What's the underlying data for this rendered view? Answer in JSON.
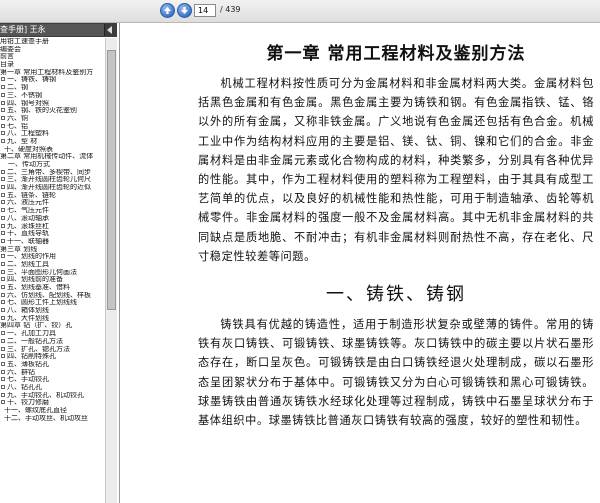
{
  "toolbar": {
    "prev_icon": "arrow-up-icon",
    "next_icon": "arrow-down-icon",
    "current_page": "14",
    "total_pages": "/ 439"
  },
  "panel": {
    "tab_title": "查手册] 王永",
    "items": [
      {
        "label": "用钳工速查手册",
        "box": false,
        "indent": 0
      },
      {
        "label": "编委会",
        "box": false,
        "indent": 0
      },
      {
        "label": "前言",
        "box": false,
        "indent": 0
      },
      {
        "label": "目录",
        "box": false,
        "indent": 0
      },
      {
        "label": "第一章  常用工程材料及鉴别方",
        "box": false,
        "indent": 0
      },
      {
        "label": "一、铸铁、铸钢",
        "box": true,
        "indent": 0
      },
      {
        "label": "二、钢",
        "box": true,
        "indent": 0
      },
      {
        "label": "三、不锈钢",
        "box": true,
        "indent": 0
      },
      {
        "label": "四、钢号对照",
        "box": true,
        "indent": 0
      },
      {
        "label": "五、钢、铁的火花鉴别",
        "box": true,
        "indent": 0
      },
      {
        "label": "六、铜",
        "box": true,
        "indent": 0
      },
      {
        "label": "七、铝",
        "box": true,
        "indent": 0
      },
      {
        "label": "八、工程塑料",
        "box": true,
        "indent": 0
      },
      {
        "label": "九、型  材",
        "box": true,
        "indent": 0
      },
      {
        "label": "十、硬度对照表",
        "box": false,
        "indent": 1
      },
      {
        "label": "第二章  常用机械传动件、流体",
        "box": false,
        "indent": 0
      },
      {
        "label": "一、传动方式",
        "box": false,
        "indent": 2
      },
      {
        "label": "二、三角带、多楔带、同步",
        "box": true,
        "indent": 0
      },
      {
        "label": "三、渐开线圆柱齿轮几何尺",
        "box": true,
        "indent": 0
      },
      {
        "label": "四、渐开线圆柱齿轮的近似",
        "box": true,
        "indent": 0
      },
      {
        "label": "五、链条、链轮",
        "box": true,
        "indent": 0
      },
      {
        "label": "六、液压元件",
        "box": true,
        "indent": 0
      },
      {
        "label": "七、气压元件",
        "box": true,
        "indent": 0
      },
      {
        "label": "八、滚动轴承",
        "box": true,
        "indent": 0
      },
      {
        "label": "九、滚珠丝杠",
        "box": true,
        "indent": 0
      },
      {
        "label": "十、直线导轨",
        "box": true,
        "indent": 0
      },
      {
        "label": "十一、联轴器",
        "box": true,
        "indent": 0
      },
      {
        "label": "第三章  划线",
        "box": false,
        "indent": 0
      },
      {
        "label": "一、划线的作用",
        "box": true,
        "indent": 0
      },
      {
        "label": "二、划线工具",
        "box": true,
        "indent": 0
      },
      {
        "label": "三、平面图形几何画法",
        "box": true,
        "indent": 0
      },
      {
        "label": "四、划线前的准备",
        "box": true,
        "indent": 0
      },
      {
        "label": "五、划线基准、借料",
        "box": true,
        "indent": 0
      },
      {
        "label": "六、仿划线、配划线、样板",
        "box": true,
        "indent": 0
      },
      {
        "label": "七、圆形工件上划线线",
        "box": true,
        "indent": 0
      },
      {
        "label": "八、箱体划线",
        "box": true,
        "indent": 0
      },
      {
        "label": "九、大件划线",
        "box": true,
        "indent": 0
      },
      {
        "label": "第四章  钻（扩、铰）孔",
        "box": false,
        "indent": 0
      },
      {
        "label": "一、孔加工刀具",
        "box": true,
        "indent": 0
      },
      {
        "label": "二、一般钻孔方法",
        "box": true,
        "indent": 0
      },
      {
        "label": "三、扩孔、锪孔方法",
        "box": true,
        "indent": 0
      },
      {
        "label": "四、钻削特殊孔",
        "box": true,
        "indent": 0
      },
      {
        "label": "五、薄板钻孔",
        "box": true,
        "indent": 0
      },
      {
        "label": "六、群钻",
        "box": true,
        "indent": 0
      },
      {
        "label": "七、手动铰孔",
        "box": true,
        "indent": 0
      },
      {
        "label": "八、钻孔孔",
        "box": true,
        "indent": 0
      },
      {
        "label": "九、手动铰孔、机动铰孔",
        "box": true,
        "indent": 0
      },
      {
        "label": "十、铰刀修磨",
        "box": true,
        "indent": 0
      },
      {
        "label": "十一、螺纹底孔直径",
        "box": false,
        "indent": 1
      },
      {
        "label": "十二、手动攻丝、机动攻丝",
        "box": false,
        "indent": 1
      }
    ]
  },
  "document": {
    "chapter_title": "第一章    常用工程材料及鉴别方法",
    "paragraph1": "机械工程材料按性质可分为金属材料和非金属材料两大类。金属材料包括黑色金属和有色金属。黑色金属主要为铸铁和钢。有色金属指铁、锰、铬以外的所有金属，又称非铁金属。广义地说有色金属还包括有色合金。机械工业中作为结构材料应用的主要是铝、镁、钛、铜、镍和它们的合金。非金属材料是由非金属元素或化合物构成的材料，种类繁多，分别具有各种优异的性能。其中，作为工程材料使用的塑料称为工程塑料，由于其具有成型工艺简单的优点，以及良好的机械性能和热性能，可用于制造轴承、齿轮等机械零件。非金属材料的强度一般不及金属材料高。其中无机非金属材料的共同缺点是质地脆、不耐冲击；有机非金属材料则耐热性不高，存在老化、尺寸稳定性较差等问题。",
    "section_title": "一、铸铁、铸钢",
    "paragraph2": "铸铁具有优越的铸造性，适用于制造形状复杂或壁薄的铸件。常用的铸铁有灰口铸铁、可锻铸铁、球墨铸铁等。灰口铸铁中的碳主要以片状石墨形态存在，断口呈灰色。可锻铸铁是由白口铸铁经退火处理制成，碳以石墨形态呈团絮状分布于基体中。可锻铸铁又分为白心可锻铸铁和黑心可锻铸铁。球墨铸铁由普通灰铸铁水经球化处理等过程制成，铸铁中石墨呈球状分布于基体组织中。球墨铸铁比普通灰口铸铁有较高的强度，较好的塑性和韧性。"
  }
}
